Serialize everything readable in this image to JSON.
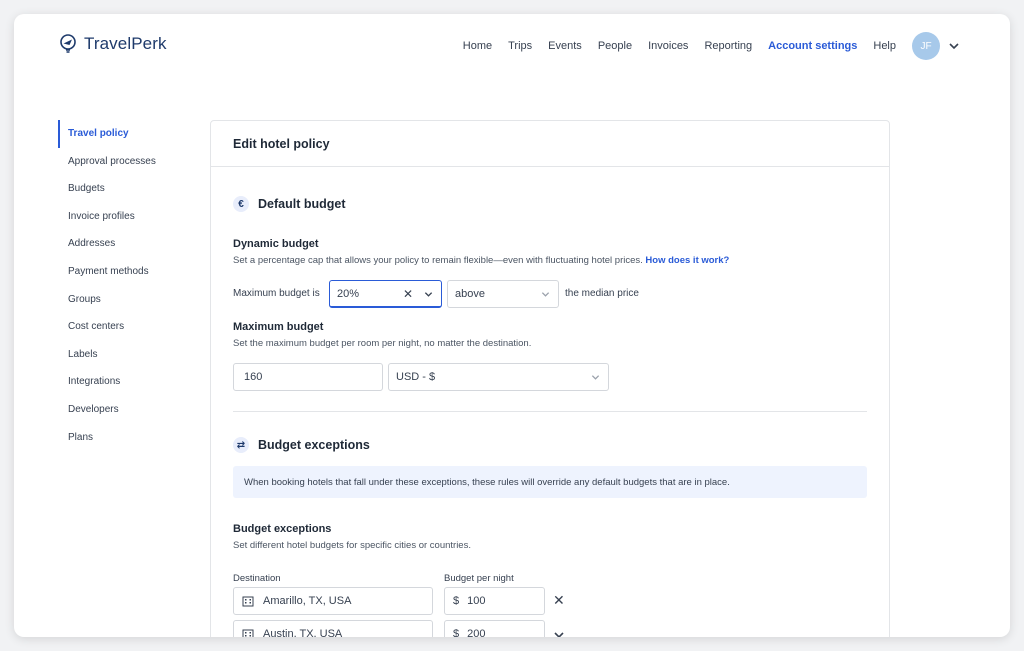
{
  "brand": {
    "name": "TravelPerk"
  },
  "nav": {
    "items": [
      {
        "label": "Home",
        "active": false
      },
      {
        "label": "Trips",
        "active": false
      },
      {
        "label": "Events",
        "active": false
      },
      {
        "label": "People",
        "active": false
      },
      {
        "label": "Invoices",
        "active": false
      },
      {
        "label": "Reporting",
        "active": false
      },
      {
        "label": "Account settings",
        "active": true
      },
      {
        "label": "Help",
        "active": false
      }
    ],
    "avatar_initials": "JF"
  },
  "sidebar": {
    "items": [
      {
        "label": "Travel policy",
        "active": true
      },
      {
        "label": "Approval processes"
      },
      {
        "label": "Budgets"
      },
      {
        "label": "Invoice profiles"
      },
      {
        "label": "Addresses"
      },
      {
        "label": "Payment methods"
      },
      {
        "label": "Groups"
      },
      {
        "label": "Cost centers"
      },
      {
        "label": "Labels"
      },
      {
        "label": "Integrations"
      },
      {
        "label": "Developers"
      },
      {
        "label": "Plans"
      }
    ]
  },
  "card": {
    "title": "Edit hotel policy",
    "default_budget": {
      "icon": "€",
      "title": "Default budget",
      "dynamic": {
        "title": "Dynamic budget",
        "description": "Set a percentage cap that allows your policy to remain flexible—even with fluctuating hotel prices.",
        "link": "How does it work?",
        "prefix_label": "Maximum budget is",
        "percent_value": "20%",
        "direction_value": "above",
        "suffix_label": "the median price"
      },
      "maximum": {
        "title": "Maximum budget",
        "description": "Set the maximum budget per room per night, no matter the destination.",
        "amount_value": "160",
        "currency_value": "USD - $"
      }
    },
    "exceptions": {
      "icon": "⇄",
      "title": "Budget exceptions",
      "notice": "When booking hotels that fall under these exceptions, these rules will override any default budgets that are in place.",
      "sub_title": "Budget exceptions",
      "description": "Set different hotel budgets for specific cities or countries.",
      "destination_header": "Destination",
      "budget_header": "Budget per night",
      "currency_symbol": "$",
      "rows": [
        {
          "destination": "Amarillo, TX, USA",
          "budget": "100"
        },
        {
          "destination": "Austin, TX, USA",
          "budget": "200"
        }
      ]
    }
  },
  "colors": {
    "accent": "#2a5bd7",
    "brand": "#1e3a6b",
    "notice_bg": "#eef3fe"
  }
}
